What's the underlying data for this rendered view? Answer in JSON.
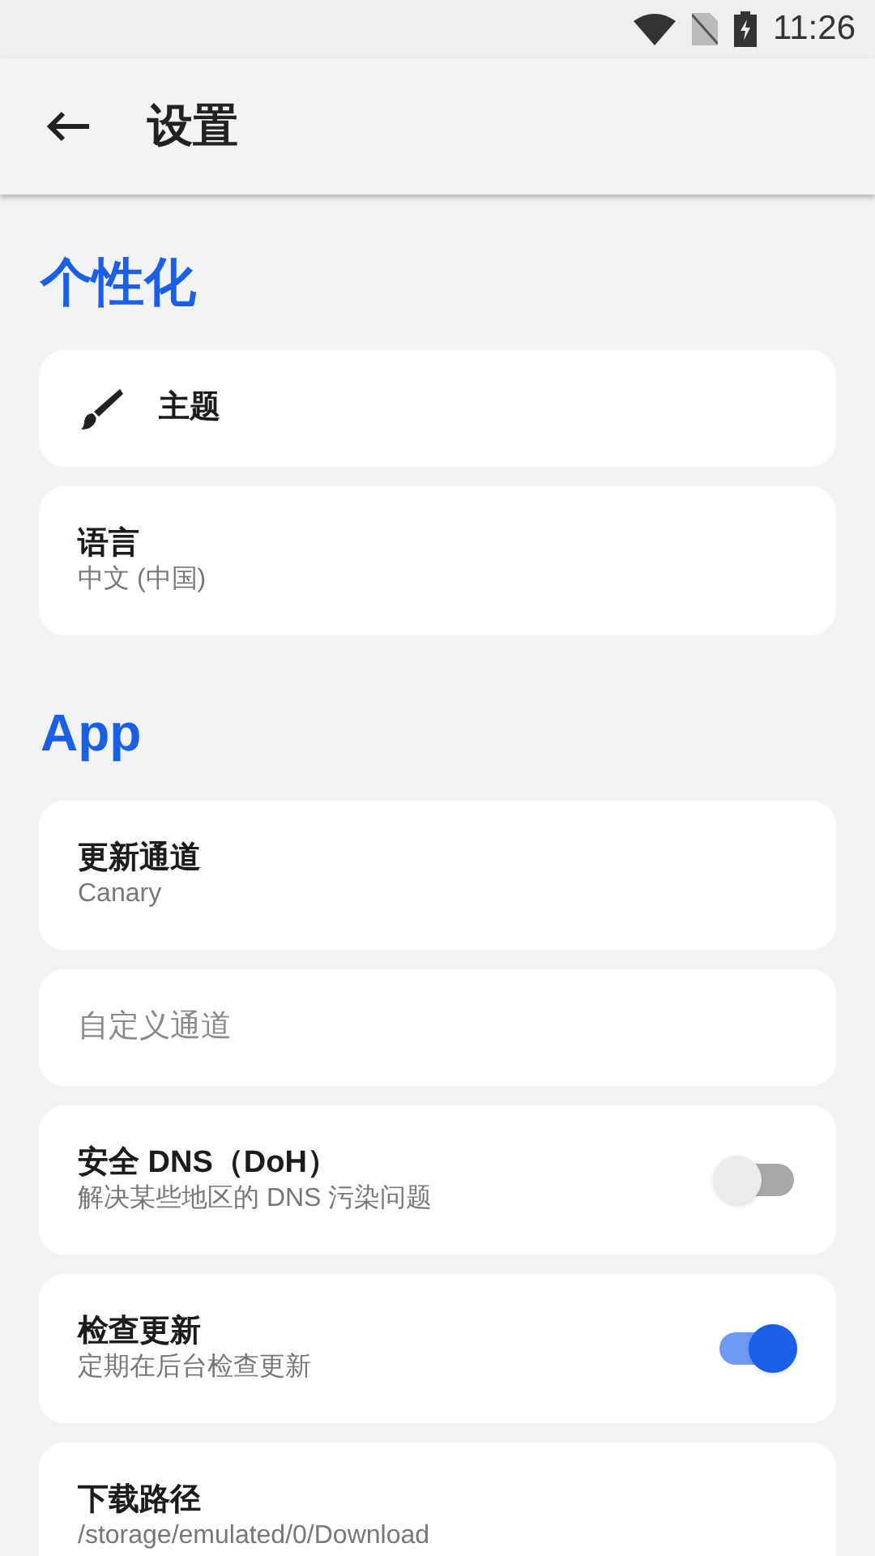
{
  "status_bar": {
    "time": "11:26"
  },
  "app_bar": {
    "title": "设置"
  },
  "sections": [
    {
      "title": "个性化",
      "items": [
        {
          "kind": "icon",
          "title": "主题"
        },
        {
          "kind": "text",
          "title": "语言",
          "subtitle": "中文 (中国)"
        }
      ]
    },
    {
      "title": "App",
      "items": [
        {
          "kind": "text",
          "title": "更新通道",
          "subtitle": "Canary"
        },
        {
          "kind": "text",
          "title": "自定义通道",
          "disabled": true
        },
        {
          "kind": "switch",
          "title": "安全 DNS（DoH）",
          "subtitle": "解决某些地区的 DNS 污染问题",
          "on": false
        },
        {
          "kind": "switch",
          "title": "检查更新",
          "subtitle": "定期在后台检查更新",
          "on": true
        },
        {
          "kind": "text",
          "title": "下载路径",
          "subtitle": "/storage/emulated/0/Download"
        }
      ]
    }
  ]
}
